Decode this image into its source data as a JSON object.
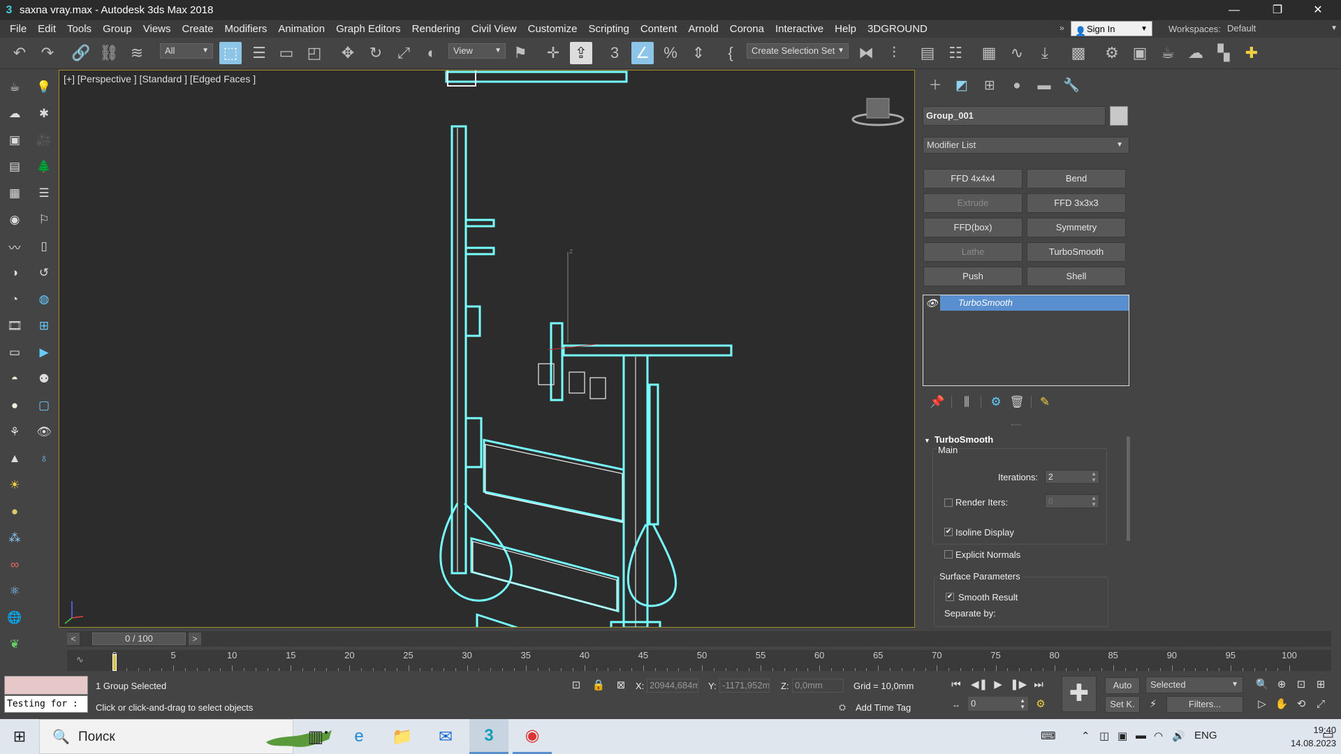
{
  "window": {
    "title": "saxna vray.max - Autodesk 3ds Max 2018"
  },
  "menus": [
    "File",
    "Edit",
    "Tools",
    "Group",
    "Views",
    "Create",
    "Modifiers",
    "Animation",
    "Graph Editors",
    "Rendering",
    "Civil View",
    "Customize",
    "Scripting",
    "Content",
    "Arnold",
    "Corona",
    "Interactive",
    "Help",
    "3DGROUND"
  ],
  "header": {
    "sign_in": "Sign In",
    "workspaces_label": "Workspaces:",
    "workspace": "Default"
  },
  "toolbar": {
    "filter": "All",
    "ref_coord": "View",
    "selection_set": "Create Selection Set"
  },
  "viewport": {
    "label": "[+] [Perspective ] [Standard ] [Edged Faces ]"
  },
  "panel": {
    "object_name": "Group_001",
    "object_color": "#c8c8c8",
    "modifier_list": "Modifier List",
    "modifier_buttons": [
      {
        "label": "FFD 4x4x4",
        "enabled": true
      },
      {
        "label": "Bend",
        "enabled": true
      },
      {
        "label": "Extrude",
        "enabled": false
      },
      {
        "label": "FFD 3x3x3",
        "enabled": true
      },
      {
        "label": "FFD(box)",
        "enabled": true
      },
      {
        "label": "Symmetry",
        "enabled": true
      },
      {
        "label": "Lathe",
        "enabled": false
      },
      {
        "label": "TurboSmooth",
        "enabled": true
      },
      {
        "label": "Push",
        "enabled": true
      },
      {
        "label": "Shell",
        "enabled": true
      }
    ],
    "stack": [
      "TurboSmooth"
    ],
    "rollout": {
      "title": "TurboSmooth",
      "main_group": "Main",
      "iterations_label": "Iterations:",
      "iterations": "2",
      "render_iters_label": "Render Iters:",
      "render_iters": "0",
      "render_iters_checked": false,
      "isoline_label": "Isoline Display",
      "isoline_checked": true,
      "explicit_label": "Explicit Normals",
      "explicit_checked": false,
      "surface_group": "Surface Parameters",
      "smooth_label": "Smooth Result",
      "smooth_checked": true,
      "separate_label": "Separate by:"
    }
  },
  "timeline": {
    "frame_display": "0 / 100",
    "ticks": [
      "0",
      "5",
      "10",
      "15",
      "20",
      "25",
      "30",
      "35",
      "40",
      "45",
      "50",
      "55",
      "60",
      "65",
      "70",
      "75",
      "80",
      "85",
      "90",
      "95",
      "100"
    ],
    "current_frame": 0,
    "total_frames": 100
  },
  "status": {
    "maxscript_text": "Testing for :",
    "selection": "1 Group Selected",
    "prompt": "Click or click-and-drag to select objects",
    "x_label": "X:",
    "x_value": "20944,684m",
    "y_label": "Y:",
    "y_value": "-1171,952m",
    "z_label": "Z:",
    "z_value": "0,0mm",
    "grid": "Grid = 10,0mm",
    "add_time_tag": "Add Time Tag",
    "frame_field": "0",
    "auto": "Auto",
    "selected": "Selected",
    "set_key": "Set K.",
    "filters": "Filters..."
  },
  "taskbar": {
    "search_placeholder": "Поиск",
    "language": "ENG",
    "time": "19:40",
    "date": "14.08.2023"
  }
}
